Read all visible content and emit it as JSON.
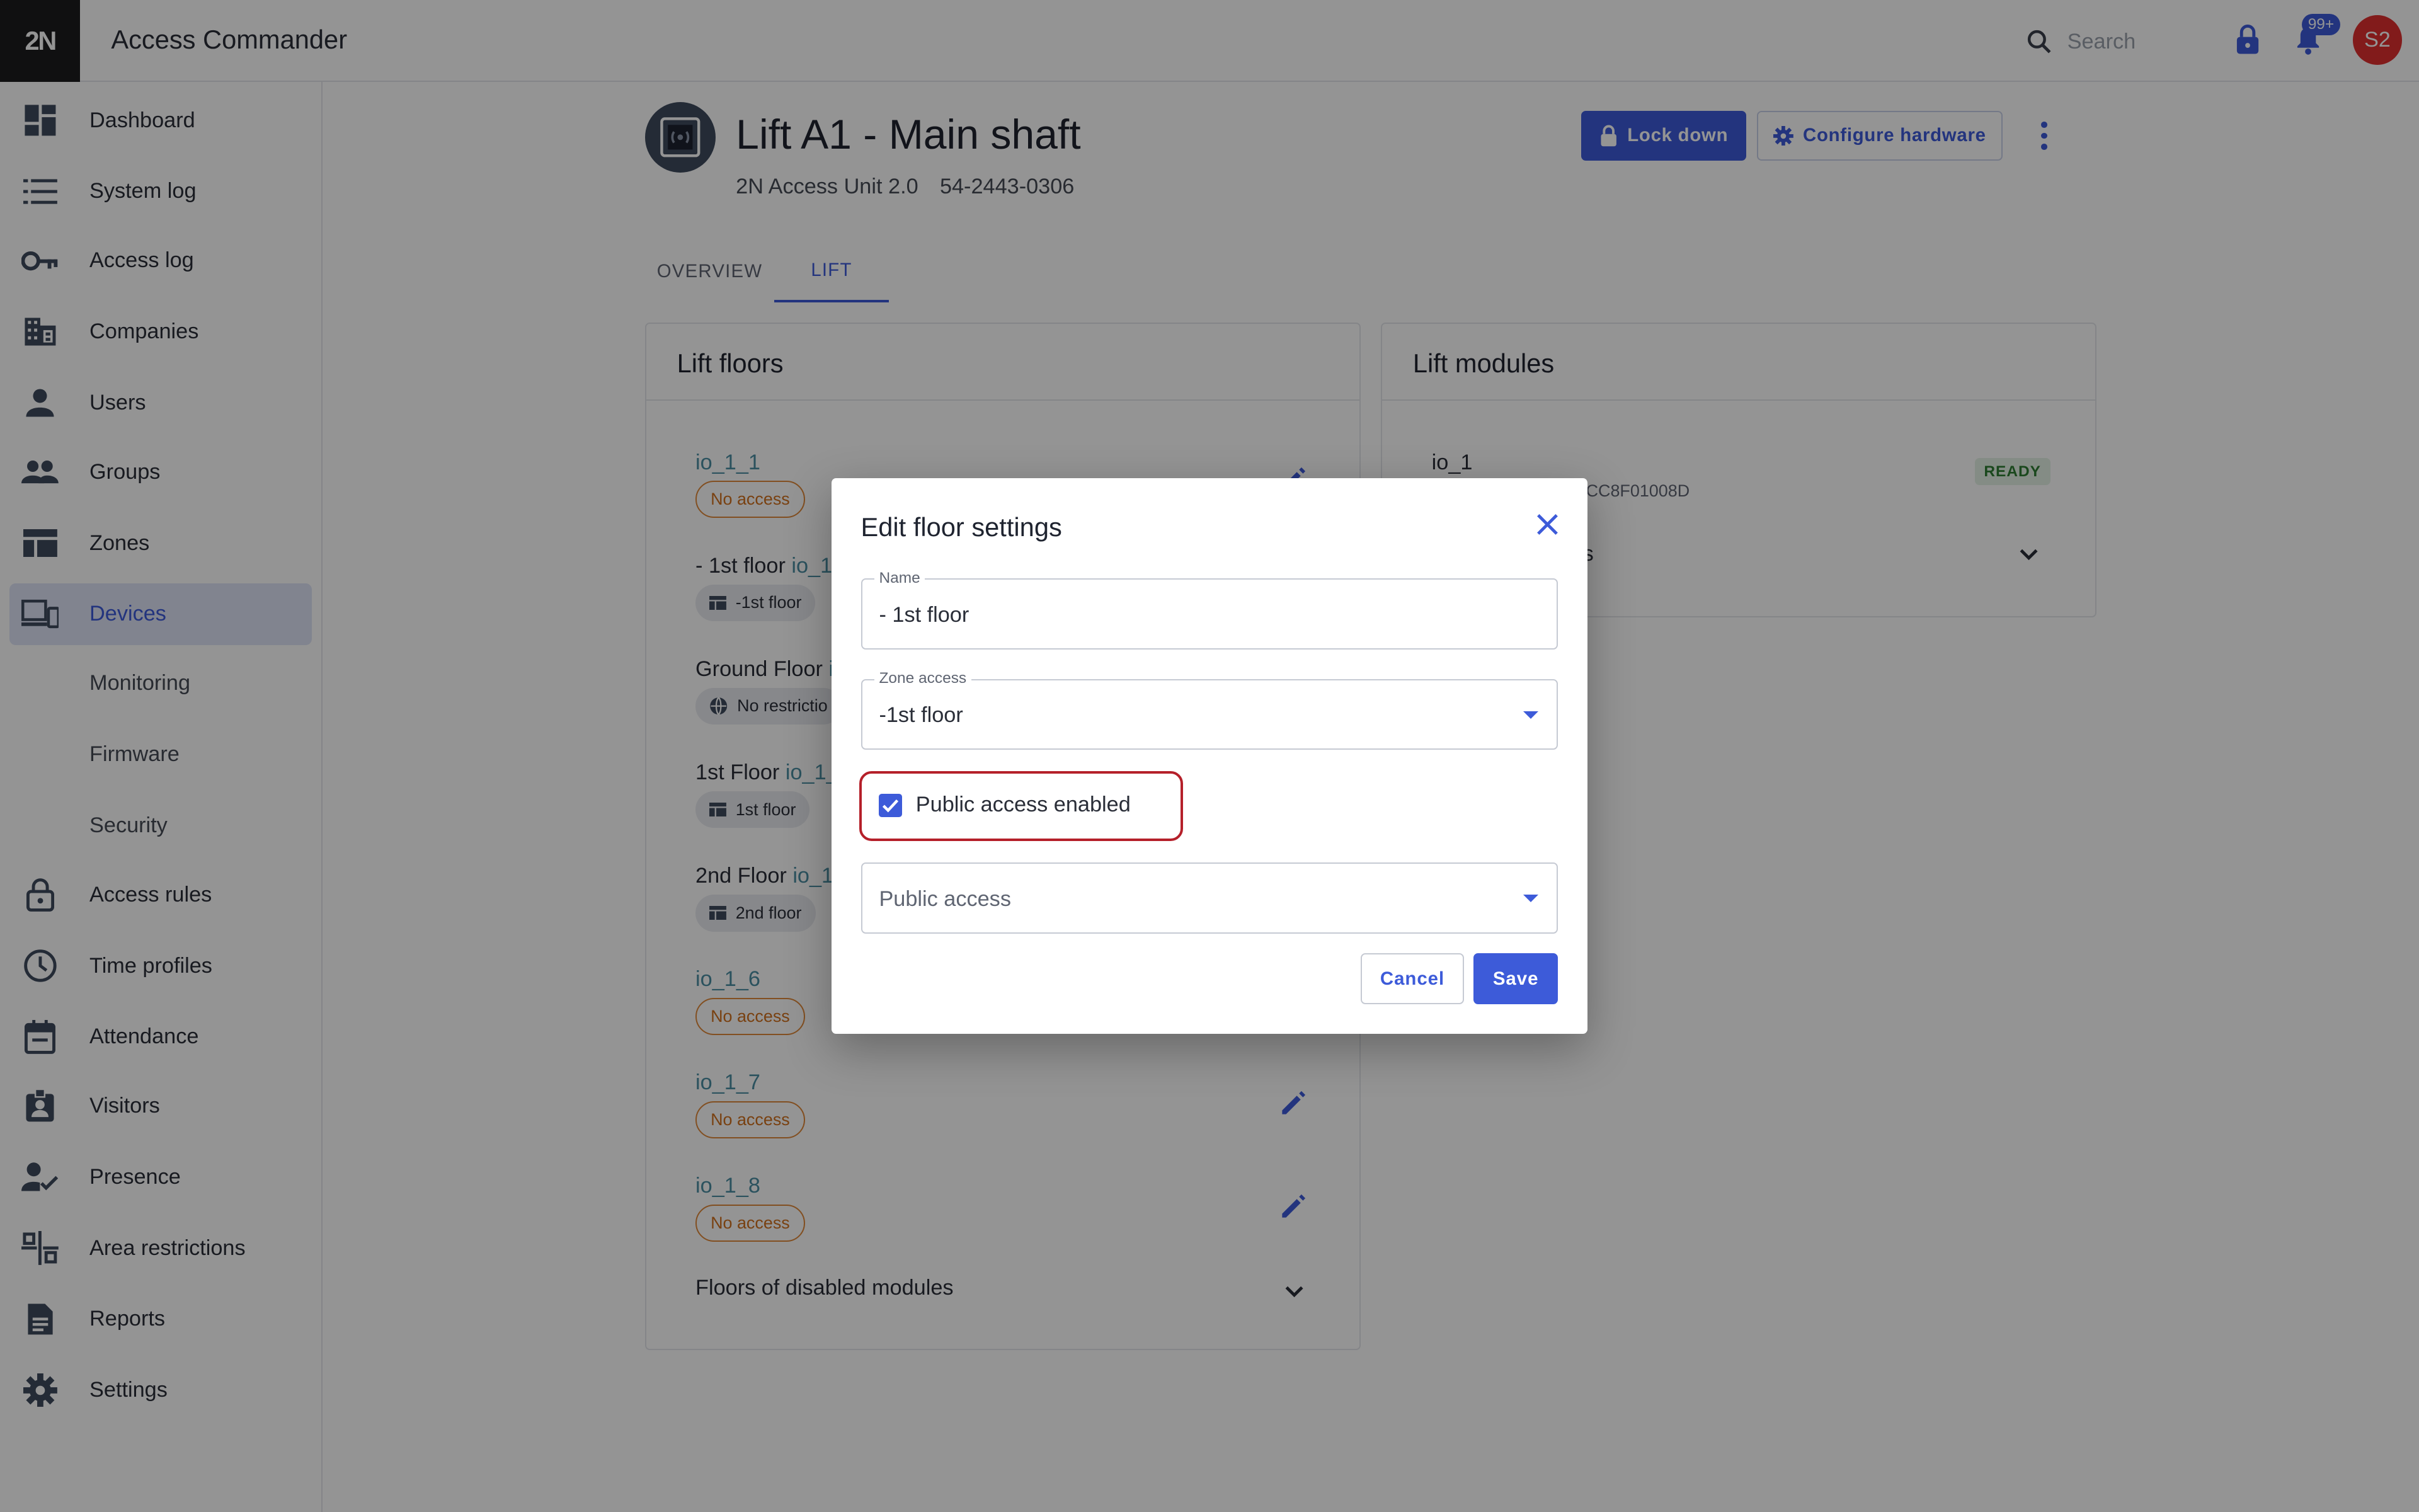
{
  "app": {
    "logo": "2N",
    "title": "Access Commander"
  },
  "topbar": {
    "search_placeholder": "Search",
    "notifications_badge": "99+",
    "avatar_initials": "S2"
  },
  "sidebar": {
    "items": [
      {
        "label": "Dashboard",
        "icon": "dashboard-icon"
      },
      {
        "label": "System log",
        "icon": "list-icon"
      },
      {
        "label": "Access log",
        "icon": "key-icon"
      },
      {
        "label": "Companies",
        "icon": "building-icon"
      },
      {
        "label": "Users",
        "icon": "person-icon"
      },
      {
        "label": "Groups",
        "icon": "people-icon"
      },
      {
        "label": "Zones",
        "icon": "zones-icon"
      },
      {
        "label": "Devices",
        "icon": "devices-icon",
        "active": true
      },
      {
        "label": "Monitoring"
      },
      {
        "label": "Firmware"
      },
      {
        "label": "Security"
      },
      {
        "label": "Access rules",
        "icon": "lock-open-icon"
      },
      {
        "label": "Time profiles",
        "icon": "clock-icon"
      },
      {
        "label": "Attendance",
        "icon": "calendar-icon"
      },
      {
        "label": "Visitors",
        "icon": "badge-icon"
      },
      {
        "label": "Presence",
        "icon": "person-check-icon"
      },
      {
        "label": "Area restrictions",
        "icon": "area-icon"
      },
      {
        "label": "Reports",
        "icon": "report-icon"
      },
      {
        "label": "Settings",
        "icon": "gear-icon"
      }
    ]
  },
  "device": {
    "title": "Lift A1 - Main shaft",
    "model": "2N Access Unit 2.0",
    "serial": "54-2443-0306",
    "lock_down_label": "Lock down",
    "configure_label": "Configure hardware"
  },
  "tabs": [
    {
      "label": "OVERVIEW"
    },
    {
      "label": "LIFT",
      "active": true
    }
  ],
  "lift_floors": {
    "title": "Lift floors",
    "floors": [
      {
        "name": "",
        "io": "io_1_1",
        "chip": "No access",
        "chip_type": "noacc"
      },
      {
        "name": "- 1st floor ",
        "io": "io_1_",
        "chip": "-1st floor",
        "chip_type": "zone"
      },
      {
        "name": "Ground Floor ",
        "io": "io",
        "chip": "No restrictio",
        "chip_type": "globe"
      },
      {
        "name": "1st Floor ",
        "io": "io_1_",
        "chip": "1st floor",
        "chip_type": "zone"
      },
      {
        "name": "2nd Floor ",
        "io": "io_1_",
        "chip": "2nd floor",
        "chip_type": "zone"
      },
      {
        "name": "",
        "io": "io_1_6",
        "chip": "No access",
        "chip_type": "noacc"
      },
      {
        "name": "",
        "io": "io_1_7",
        "chip": "No access",
        "chip_type": "noacc"
      },
      {
        "name": "",
        "io": "io_1_8",
        "chip": "No access",
        "chip_type": "noacc"
      }
    ],
    "disabled_label": "Floors of disabled modules"
  },
  "lift_modules": {
    "title": "Lift modules",
    "module_name": "io_1",
    "module_id": "CC8F01008D",
    "status": "READY",
    "subtext": "s"
  },
  "dialog": {
    "title": "Edit floor settings",
    "name_label": "Name",
    "name_value": "- 1st floor",
    "zone_label": "Zone access",
    "zone_value": "-1st floor",
    "public_checkbox_label": "Public access enabled",
    "public_checked": true,
    "public_access_placeholder": "Public access",
    "cancel_label": "Cancel",
    "save_label": "Save"
  },
  "colors": {
    "accent": "#3d5bd9",
    "highlight": "#b5202a",
    "no_access": "#d0701e",
    "ready": "#2e7d32",
    "avatar": "#e03030"
  }
}
